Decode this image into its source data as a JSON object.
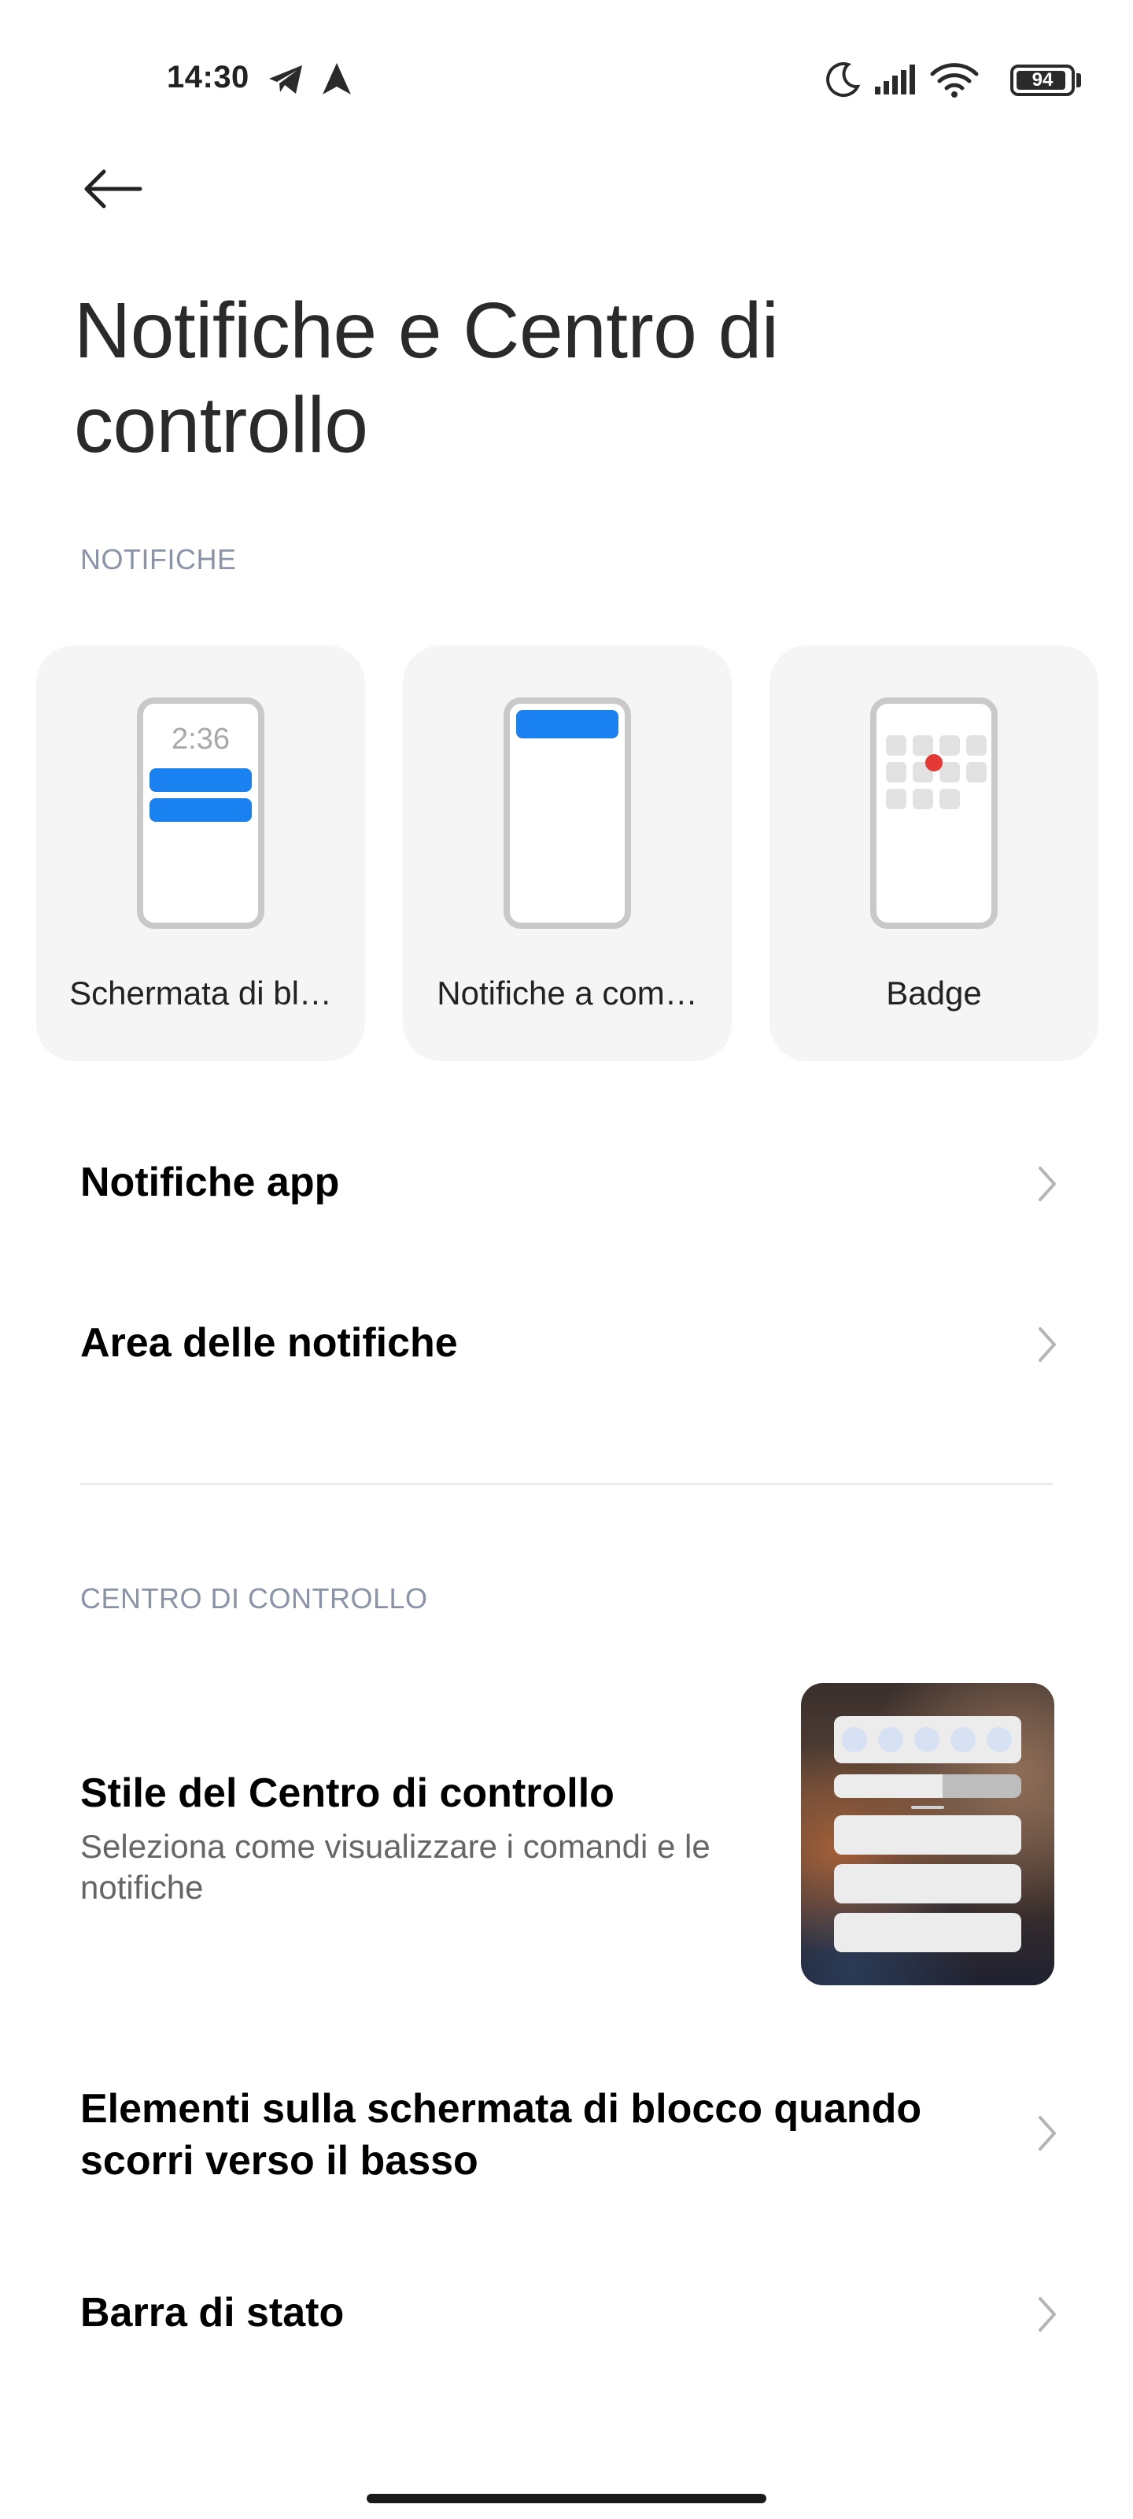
{
  "status_bar": {
    "time": "14:30",
    "left_icons": [
      "telegram-icon",
      "navigation-arrow-icon"
    ],
    "right_icons": [
      "do-not-disturb-moon-icon",
      "signal-icon",
      "wifi-icon"
    ],
    "battery_level": "94"
  },
  "header": {
    "back_icon": "back-arrow-icon",
    "title": "Notifiche e Centro di controllo"
  },
  "notifications_section": {
    "header": "NOTIFICHE",
    "cards": [
      {
        "label": "Schermata di bl…",
        "preview_time": "2:36"
      },
      {
        "label": "Notifiche a com…"
      },
      {
        "label": "Badge"
      }
    ],
    "rows": [
      {
        "label": "Notifiche app"
      },
      {
        "label": "Area delle notifiche"
      }
    ]
  },
  "control_center_section": {
    "header": "CENTRO DI CONTROLLO",
    "style_row": {
      "title": "Stile del Centro di controllo",
      "subtitle": "Seleziona come visualizzare i comandi e le notifiche"
    },
    "rows": [
      {
        "label": "Elementi sulla schermata di blocco quando scorri verso il basso"
      },
      {
        "label": "Barra di stato"
      }
    ]
  },
  "colors": {
    "accent_blue": "#1a82f0",
    "badge_red": "#e53935",
    "section_header": "#8a93a8"
  }
}
